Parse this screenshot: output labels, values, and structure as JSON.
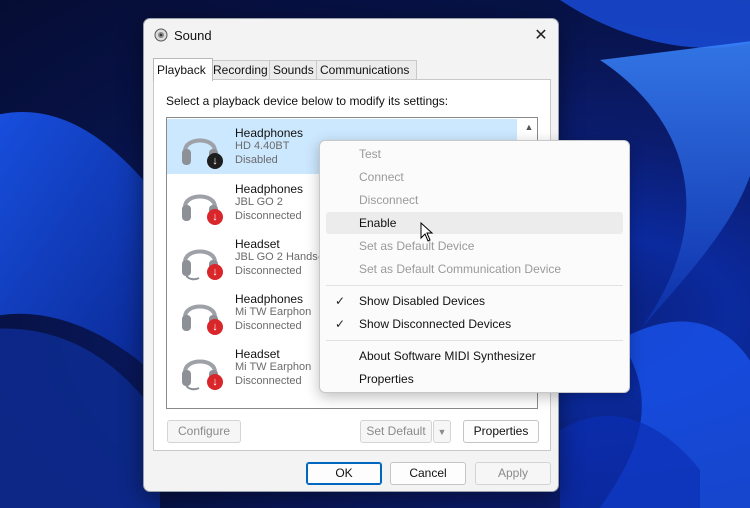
{
  "window": {
    "title": "Sound",
    "close_label": "✕"
  },
  "tabs": [
    {
      "label": "Playback",
      "active": true
    },
    {
      "label": "Recording",
      "active": false
    },
    {
      "label": "Sounds",
      "active": false
    },
    {
      "label": "Communications",
      "active": false
    }
  ],
  "instruction": "Select a playback device below to modify its settings:",
  "devices": [
    {
      "name": "Headphones",
      "model": "HD 4.40BT",
      "status": "Disabled",
      "icon": "headphones-icon",
      "badge": "disabled",
      "selected": true
    },
    {
      "name": "Headphones",
      "model": "JBL GO 2",
      "status": "Disconnected",
      "icon": "headphones-icon",
      "badge": "disconnected",
      "selected": false
    },
    {
      "name": "Headset",
      "model": "JBL GO 2 Hands-",
      "status": "Disconnected",
      "icon": "headset-icon",
      "badge": "disconnected",
      "selected": false
    },
    {
      "name": "Headphones",
      "model": "Mi TW Earphon",
      "status": "Disconnected",
      "icon": "headphones-icon",
      "badge": "disconnected",
      "selected": false
    },
    {
      "name": "Headset",
      "model": "Mi TW Earphon",
      "status": "Disconnected",
      "icon": "headset-icon",
      "badge": "disconnected",
      "selected": false
    }
  ],
  "buttons": {
    "configure": "Configure",
    "set_default": "Set Default",
    "properties": "Properties",
    "ok": "OK",
    "cancel": "Cancel",
    "apply": "Apply"
  },
  "context_menu": [
    {
      "label": "Test",
      "disabled": true
    },
    {
      "label": "Connect",
      "disabled": true
    },
    {
      "label": "Disconnect",
      "disabled": true
    },
    {
      "label": "Enable",
      "disabled": false,
      "hover": true
    },
    {
      "label": "Set as Default Device",
      "disabled": true
    },
    {
      "label": "Set as Default Communication Device",
      "disabled": true
    },
    {
      "label": "Show Disabled Devices",
      "checked": true
    },
    {
      "label": "Show Disconnected Devices",
      "checked": true
    },
    {
      "label": "About Software MIDI Synthesizer",
      "disabled": false
    },
    {
      "label": "Properties",
      "disabled": false
    }
  ],
  "colors": {
    "selection": "#cce8ff",
    "primary_border": "#0067c0",
    "badge_red": "#d9262a",
    "badge_dark": "#1e1e1e"
  }
}
